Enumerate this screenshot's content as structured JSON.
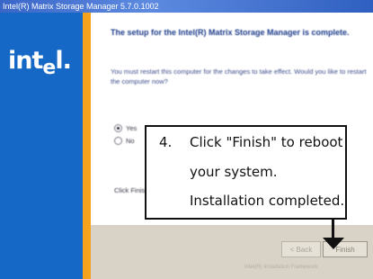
{
  "window": {
    "title": "Intel(R) Matrix Storage Manager 5.7.0.1002"
  },
  "logo": {
    "text_main": "int",
    "text_e": "e",
    "text_end": "l."
  },
  "dialog": {
    "heading": "The setup for the Intel(R) Matrix Storage Manager is complete.",
    "body": "You must restart this computer for the changes to take effect. Would you like to restart the computer now?",
    "radio_yes": "Yes",
    "radio_no": "No",
    "click_text": "Click Finish"
  },
  "buttons": {
    "back": "< Back",
    "finish": "Finish"
  },
  "footer": {
    "text": "Intel(R) Installation Framework"
  },
  "callout": {
    "number": "4.",
    "line1": "Click \"Finish\" to reboot",
    "line2": "your system.",
    "line3": "Installation completed."
  }
}
